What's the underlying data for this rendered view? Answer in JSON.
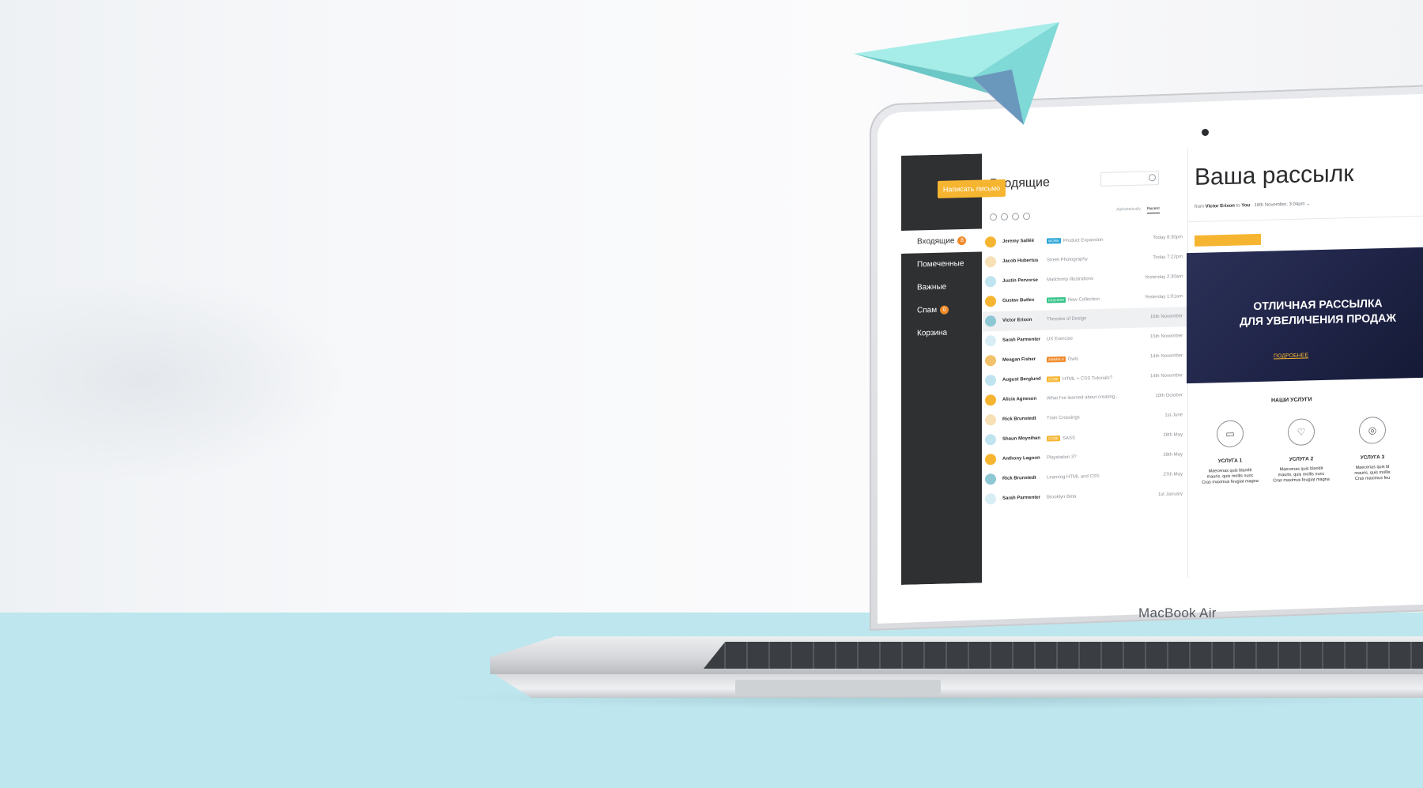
{
  "laptop": {
    "brand": "MacBook Air"
  },
  "colors": {
    "accent": "#f6b531",
    "badge": "#f08a2a",
    "sidebar": "#2f3032",
    "banner": "#1f2447",
    "desk": "#bde6ee",
    "plane": "#8fe0de"
  },
  "sidebar": {
    "compose_label": "Написать письмо",
    "items": [
      {
        "label": "Входящие",
        "badge": "8",
        "active": true
      },
      {
        "label": "Помеченные",
        "badge": ""
      },
      {
        "label": "Важные",
        "badge": ""
      },
      {
        "label": "Спам",
        "badge": "0"
      },
      {
        "label": "Корзина",
        "badge": ""
      }
    ]
  },
  "inbox": {
    "title": "Входящие",
    "search_placeholder": "",
    "sort_tabs": [
      "Alphabetically",
      "Recent"
    ],
    "active_sort": "Recent",
    "messages": [
      {
        "sender": "Jeremy Salléé",
        "tag": "WORK",
        "tag_color": "#2aa6d8",
        "subject": "Product Expansion",
        "time": "Today 8:30pm",
        "avatar": "#f6b531"
      },
      {
        "sender": "Jacob Hubertus",
        "tag": "",
        "subject": "Street Photography",
        "time": "Today 7:22pm",
        "avatar": "#f7dfb6"
      },
      {
        "sender": "Justin Pervorse",
        "tag": "",
        "subject": "Mailchimp Illustrations",
        "time": "Yesterday 2:30am",
        "avatar": "#bfe4f0"
      },
      {
        "sender": "Gustav Butlex",
        "tag": "FASHION",
        "tag_color": "#35c48a",
        "subject": "New Collection",
        "time": "Yesterday 1:01am",
        "avatar": "#f6b531"
      },
      {
        "sender": "Victor Erixon",
        "tag": "",
        "subject": "Theories of Design",
        "time": "16th November",
        "avatar": "#8ec7d4",
        "selected": true
      },
      {
        "sender": "Sarah Parmenter",
        "tag": "",
        "subject": "UX Exercise",
        "time": "15th November",
        "avatar": "#d8eef4"
      },
      {
        "sender": "Meagan Fisher",
        "tag": "ANIMALS",
        "tag_color": "#f08a2a",
        "subject": "Owls",
        "time": "14th November",
        "avatar": "#f2c26a"
      },
      {
        "sender": "August Berglund",
        "tag": "CODE",
        "tag_color": "#f6b531",
        "subject": "HTML + CSS Tutorials?",
        "time": "14th November",
        "avatar": "#bfe4f0"
      },
      {
        "sender": "Alicia Agneson",
        "tag": "",
        "subject": "What I've learned about creating...",
        "time": "10th October",
        "avatar": "#f6b531"
      },
      {
        "sender": "Rick Brunstedt",
        "tag": "",
        "subject": "Train Crossings",
        "time": "1st June",
        "avatar": "#f7dfb6"
      },
      {
        "sender": "Shaun Moynihan",
        "tag": "CODE",
        "tag_color": "#f6b531",
        "subject": "SASS",
        "time": "28th May",
        "avatar": "#bfe4f0"
      },
      {
        "sender": "Anthony Lagoon",
        "tag": "",
        "subject": "Playstation 3?",
        "time": "28th May",
        "avatar": "#f6b531"
      },
      {
        "sender": "Rick Brunstedt",
        "tag": "",
        "subject": "Learning HTML and CSS",
        "time": "27th May",
        "avatar": "#8ec7d4"
      },
      {
        "sender": "Sarah Parmenter",
        "tag": "",
        "subject": "Brooklyn Beta",
        "time": "1st January",
        "avatar": "#d8eef4"
      }
    ]
  },
  "message_view": {
    "title": "Ваша рассылк",
    "meta_prefix": "from",
    "meta_from": "Victor Erixon",
    "meta_to_word": "to",
    "meta_to": "You",
    "meta_date": "16th November, 3:04pm",
    "banner_title_line1": "ОТЛИЧНАЯ РАССЫЛКА",
    "banner_title_line2": "ДЛЯ УВЕЛИЧЕНИЯ ПРОДАЖ",
    "banner_link": "ПОДРОБНЕЕ",
    "services_heading": "НАШИ УСЛУГИ",
    "services": [
      {
        "icon": "laptop-icon",
        "glyph": "▭",
        "title": "УСЛУГА 1",
        "text_lines": [
          "Maecenas quis blandit",
          "mauris, quis mollis nunc",
          "Cras maximus feugiat magna"
        ]
      },
      {
        "icon": "heart-icon",
        "glyph": "♡",
        "title": "УСЛУГА 2",
        "text_lines": [
          "Maecenas quis blandit",
          "mauris, quis mollis nunc",
          "Cras maximus feugiat magna"
        ]
      },
      {
        "icon": "lifebuoy-icon",
        "glyph": "◎",
        "title": "УСЛУГА 3",
        "text_lines": [
          "Maecenas quis bl",
          "mauris, quis mollis",
          "Cras maximus feu"
        ]
      }
    ]
  }
}
